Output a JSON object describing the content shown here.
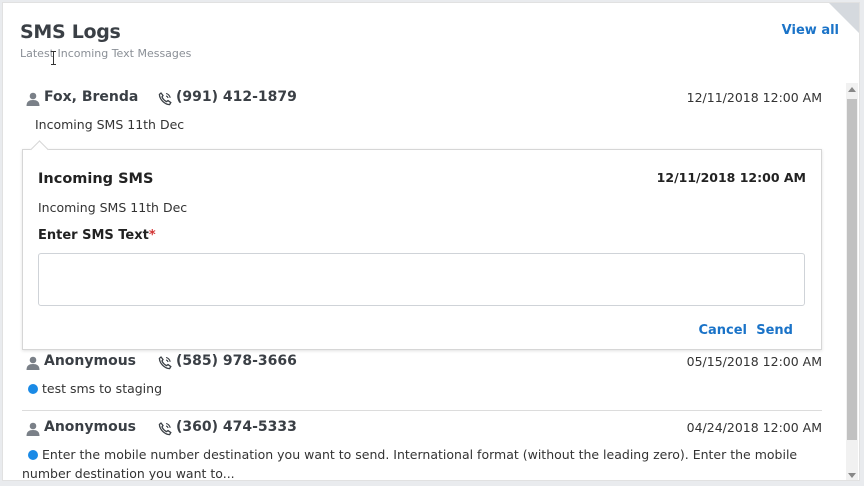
{
  "header": {
    "title": "SMS Logs",
    "subtitle": "Latest Incoming Text Messages",
    "view_all": "View all"
  },
  "logs": [
    {
      "name": "Fox, Brenda",
      "phone": "(991) 412-1879",
      "date": "12/11/2018 12:00 AM",
      "message": "Incoming SMS 11th Dec",
      "unread": false
    },
    {
      "name": "Anonymous",
      "phone": "(585) 978-3666",
      "date": "05/15/2018 12:00 AM",
      "message": "test sms to staging",
      "unread": true
    },
    {
      "name": "Anonymous",
      "phone": "(360) 474-5333",
      "date": "04/24/2018 12:00 AM",
      "message": "Enter the mobile number destination you want to send. International format (without the leading zero). Enter the mobile number destination you want to...",
      "unread": true
    }
  ],
  "popover": {
    "title": "Incoming SMS",
    "date": "12/11/2018 12:00 AM",
    "message": "Incoming SMS 11th Dec",
    "field_label": "Enter SMS Text",
    "required_mark": "*",
    "input_value": "",
    "cancel": "Cancel",
    "send": "Send"
  },
  "colors": {
    "link": "#1a73c8",
    "unread_dot": "#1a8ae6",
    "required": "#d23333"
  }
}
